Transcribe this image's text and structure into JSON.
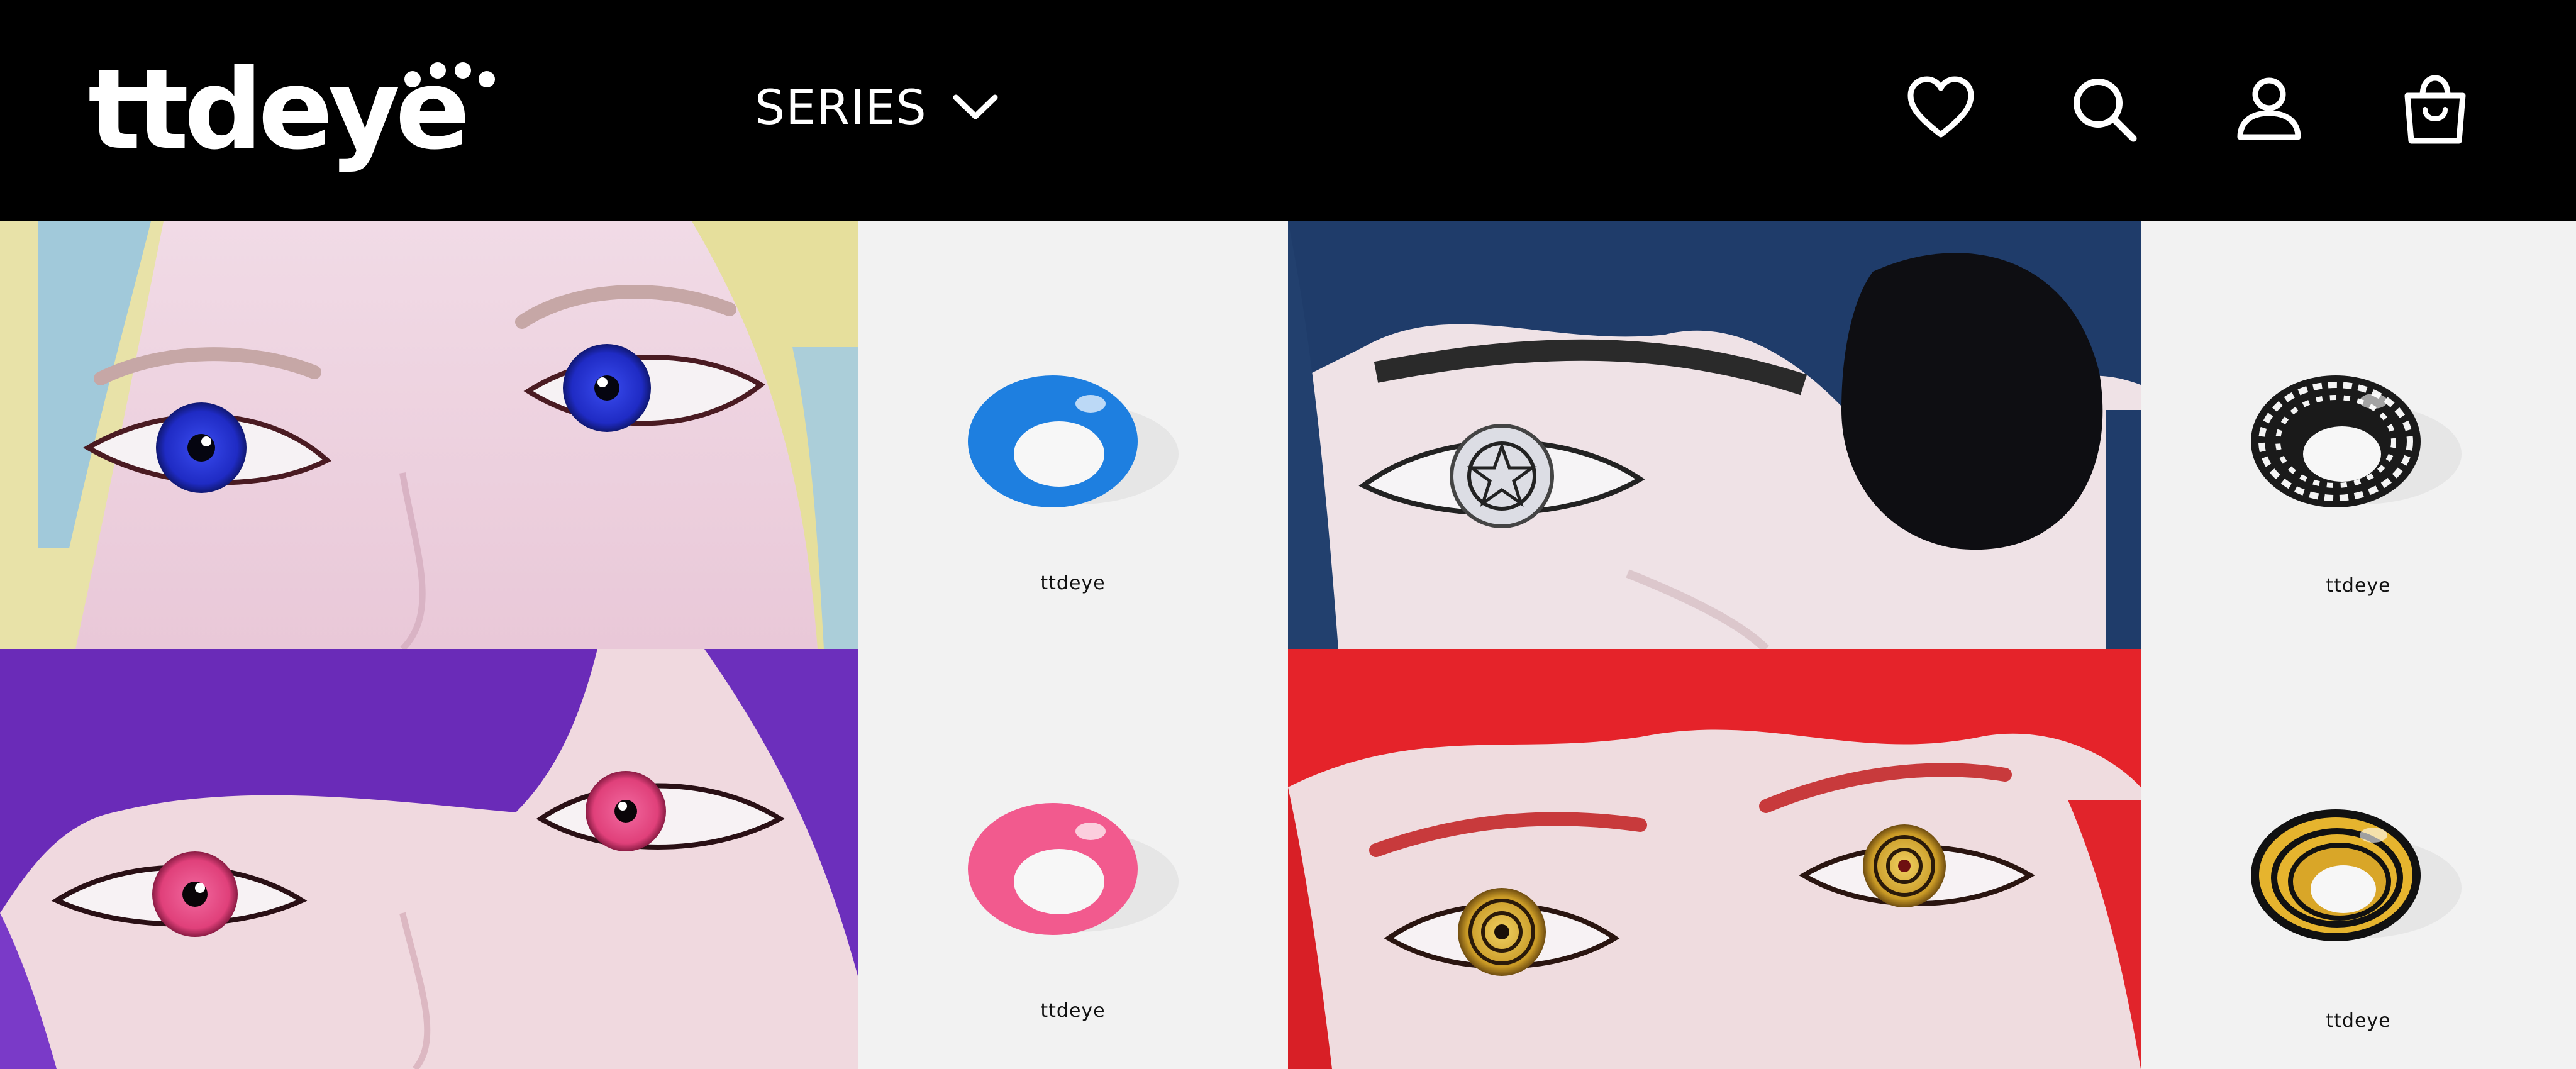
{
  "header": {
    "logo_text": "ttdeye",
    "nav_series_label": "SERIES",
    "icons": [
      "heart-icon",
      "search-icon",
      "account-icon",
      "shopping-bag-icon"
    ]
  },
  "colors": {
    "header_bg": "#000000",
    "panel_bg": "#f2f2f2",
    "lens_blue": "#1e7fe0",
    "lens_pink": "#f25a8e",
    "lens_gold": "#e6b42e",
    "lens_bw": "#222222"
  },
  "products": [
    {
      "photo": "blue-eyes-blonde-wig",
      "lens_color": "blue",
      "brand": "ttdeye"
    },
    {
      "photo": "sebastian-pentagram-eye-patch",
      "lens_color": "black-white",
      "brand": "ttdeye"
    },
    {
      "photo": "pink-eyes-purple-wig",
      "lens_color": "pink",
      "brand": "ttdeye"
    },
    {
      "photo": "yellow-spiral-eyes-red-wig",
      "lens_color": "yellow",
      "brand": "ttdeye"
    }
  ]
}
